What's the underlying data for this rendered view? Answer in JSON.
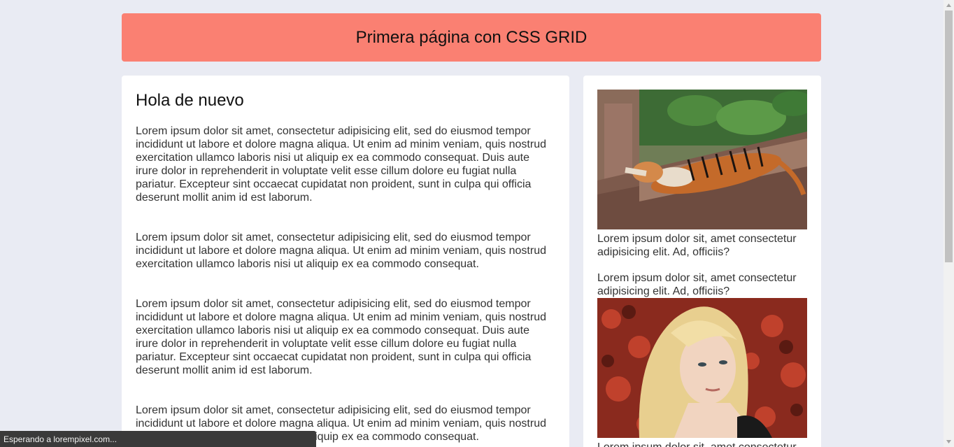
{
  "header": {
    "title": "Primera página con CSS GRID"
  },
  "main": {
    "heading": "Hola de nuevo",
    "paragraphs": [
      "Lorem ipsum dolor sit amet, consectetur adipisicing elit, sed do eiusmod tempor incididunt ut labore et dolore magna aliqua. Ut enim ad minim veniam, quis nostrud exercitation ullamco laboris nisi ut aliquip ex ea commodo consequat. Duis aute irure dolor in reprehenderit in voluptate velit esse cillum dolore eu fugiat nulla pariatur. Excepteur sint occaecat cupidatat non proident, sunt in culpa qui officia deserunt mollit anim id est laborum.",
      "Lorem ipsum dolor sit amet, consectetur adipisicing elit, sed do eiusmod tempor incididunt ut labore et dolore magna aliqua. Ut enim ad minim veniam, quis nostrud exercitation ullamco laboris nisi ut aliquip ex ea commodo consequat.",
      "Lorem ipsum dolor sit amet, consectetur adipisicing elit, sed do eiusmod tempor incididunt ut labore et dolore magna aliqua. Ut enim ad minim veniam, quis nostrud exercitation ullamco laboris nisi ut aliquip ex ea commodo consequat. Duis aute irure dolor in reprehenderit in voluptate velit esse cillum dolore eu fugiat nulla pariatur. Excepteur sint occaecat cupidatat non proident, sunt in culpa qui officia deserunt mollit anim id est laborum.",
      "Lorem ipsum dolor sit amet, consectetur adipisicing elit, sed do eiusmod tempor incididunt ut labore et dolore magna aliqua. Ut enim ad minim veniam, quis nostrud exercitation ullamco laboris nisi ut aliquip ex ea commodo consequat."
    ]
  },
  "aside": {
    "caption_1": "Lorem ipsum dolor sit, amet consectetur adipisicing elit. Ad, officiis?",
    "caption_2": "Lorem ipsum dolor sit, amet consectetur adipisicing elit. Ad, officiis?",
    "caption_3": "Lorem ipsum dolor sit, amet consectetur"
  },
  "status_bar": {
    "text": "Esperando a lorempixel.com..."
  },
  "colors": {
    "header_bg": "#fa8072",
    "page_bg": "#e9ebf3",
    "card_bg": "#ffffff"
  }
}
